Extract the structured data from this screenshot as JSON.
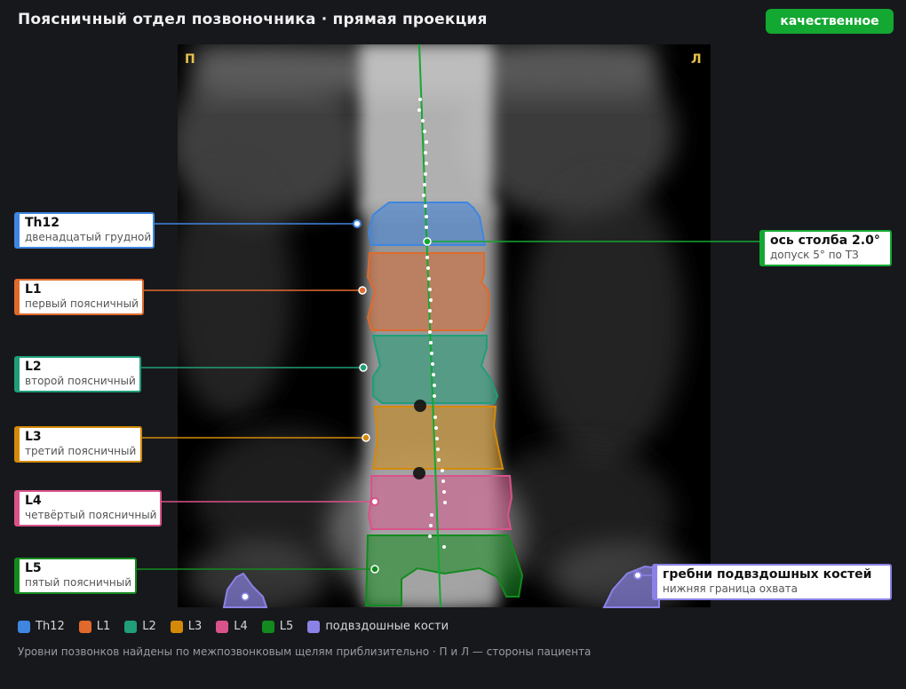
{
  "header": {
    "title": "Поясничный отдел позвоночника · прямая проекция",
    "badge": "качественное",
    "badge_color": "#13a831"
  },
  "image": {
    "side_right_marker": "П",
    "side_left_marker": "Л"
  },
  "vertebrae": [
    {
      "key": "th12",
      "title": "Th12",
      "subtitle": "двенадцатый грудной",
      "color": "#3f86e0"
    },
    {
      "key": "l1",
      "title": "L1",
      "subtitle": "первый поясничный",
      "color": "#e06a2c"
    },
    {
      "key": "l2",
      "title": "L2",
      "subtitle": "второй поясничный",
      "color": "#1f9e78"
    },
    {
      "key": "l3",
      "title": "L3",
      "subtitle": "третий поясничный",
      "color": "#d48a08"
    },
    {
      "key": "l4",
      "title": "L4",
      "subtitle": "четвёртый поясничный",
      "color": "#d9528a"
    },
    {
      "key": "l5",
      "title": "L5",
      "subtitle": "пятый поясничный",
      "color": "#138a1e"
    }
  ],
  "axis": {
    "title": "ось столба 2.0°",
    "subtitle": "допуск 5° по ТЗ",
    "color": "#13a831"
  },
  "iliac": {
    "title": "гребни подвздошных костей",
    "subtitle": "нижняя граница охвата",
    "color": "#8a82e6"
  },
  "legend": [
    {
      "label": "Th12",
      "color": "#3f86e0"
    },
    {
      "label": "L1",
      "color": "#e06a2c"
    },
    {
      "label": "L2",
      "color": "#1f9e78"
    },
    {
      "label": "L3",
      "color": "#d48a08"
    },
    {
      "label": "L4",
      "color": "#d9528a"
    },
    {
      "label": "L5",
      "color": "#138a1e"
    },
    {
      "label": "подвздошные кости",
      "color": "#8a82e6"
    }
  ],
  "footnote": "Уровни позвонков найдены по межпозвонковым щелям приблизительно · П и Л — стороны пациента"
}
